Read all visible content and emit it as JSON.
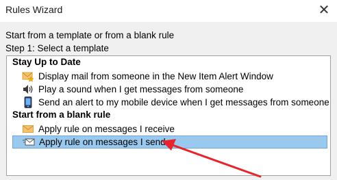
{
  "window": {
    "title": "Rules Wizard",
    "close_icon": "close-icon"
  },
  "prompts": {
    "line1": "Start from a template or from a blank rule",
    "line2": "Step 1: Select a template"
  },
  "template_list": {
    "groups": [
      {
        "header": "Stay Up to Date",
        "items": [
          {
            "label": "Display mail from someone in the New Item Alert Window",
            "icon": "envelope-star-icon"
          },
          {
            "label": "Play a sound when I get messages from someone",
            "icon": "speaker-icon"
          },
          {
            "label": "Send an alert to my mobile device when I get messages from someone",
            "icon": "mobile-phone-icon"
          }
        ]
      },
      {
        "header": "Start from a blank rule",
        "items": [
          {
            "label": "Apply rule on messages I receive",
            "icon": "envelope-icon"
          },
          {
            "label": "Apply rule on messages I send",
            "icon": "sent-envelope-icon",
            "selected": true
          }
        ]
      }
    ]
  },
  "colors": {
    "selection": "#99c9ef",
    "annotation_arrow": "#e8252a"
  }
}
